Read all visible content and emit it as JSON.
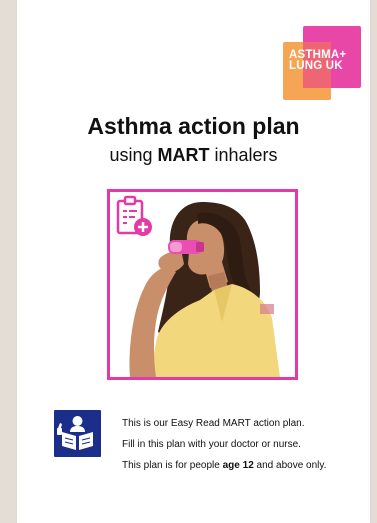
{
  "logo": {
    "line1": "ASTHMA+",
    "line2": "LUNG UK",
    "colors": {
      "orange": "#f4a04a",
      "pink": "#e7379f"
    }
  },
  "title": "Asthma action plan",
  "subtitle": {
    "prefix": "using ",
    "bold": "MART",
    "suffix": " inhalers"
  },
  "photo": {
    "border_color": "#e33aa8",
    "icon": "clipboard-plus-icon"
  },
  "easy_read": {
    "icon": "easy-read-icon",
    "icon_color": "#1b2e8a",
    "line1": "This is our Easy Read MART action plan.",
    "line2": "Fill in this plan with your doctor or nurse.",
    "line3_prefix": "This plan is for people ",
    "line3_bold": "age 12",
    "line3_suffix": " and above only."
  }
}
